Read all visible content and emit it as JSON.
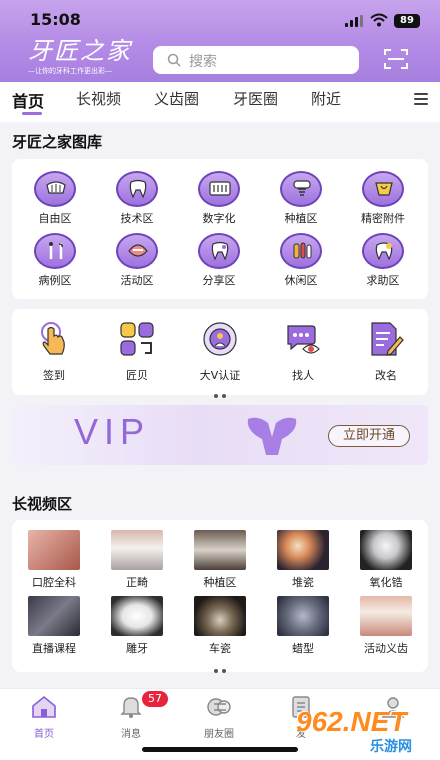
{
  "status_bar": {
    "time": "15:08",
    "battery": "89"
  },
  "header": {
    "logo_title": "牙匠之家",
    "logo_slogan": "—让你的牙科工作更出彩—",
    "search_placeholder": "搜索"
  },
  "tabs": [
    {
      "label": "首页",
      "active": true
    },
    {
      "label": "长视频",
      "active": false
    },
    {
      "label": "义齿圈",
      "active": false
    },
    {
      "label": "牙医圈",
      "active": false
    },
    {
      "label": "附近",
      "active": false
    }
  ],
  "gallery": {
    "title": "牙匠之家图库",
    "items": [
      {
        "label": "自由区",
        "icon": "teeth-icon"
      },
      {
        "label": "技术区",
        "icon": "tooth-icon"
      },
      {
        "label": "数字化",
        "icon": "digital-teeth-icon"
      },
      {
        "label": "种植区",
        "icon": "implant-icon"
      },
      {
        "label": "精密附件",
        "icon": "crown-icon"
      },
      {
        "label": "病例区",
        "icon": "dental-tools-icon"
      },
      {
        "label": "活动区",
        "icon": "denture-icon"
      },
      {
        "label": "分享区",
        "icon": "share-tooth-icon"
      },
      {
        "label": "休闲区",
        "icon": "leisure-icon"
      },
      {
        "label": "求助区",
        "icon": "help-icon"
      }
    ]
  },
  "tools": {
    "items": [
      {
        "label": "签到",
        "icon": "tap-hand-icon"
      },
      {
        "label": "匠贝",
        "icon": "coin-icon"
      },
      {
        "label": "大V认证",
        "icon": "verified-badge-icon"
      },
      {
        "label": "找人",
        "icon": "chat-find-icon"
      },
      {
        "label": "改名",
        "icon": "edit-doc-icon"
      }
    ]
  },
  "vip_banner": {
    "text": "VIP",
    "button": "立即开通"
  },
  "videos": {
    "title": "长视频区",
    "items": [
      {
        "label": "口腔全科",
        "color": "#c98a7a"
      },
      {
        "label": "正畸",
        "color": "#b9a3a0"
      },
      {
        "label": "种植区",
        "color": "#5d5046"
      },
      {
        "label": "堆瓷",
        "color": "#3b3038"
      },
      {
        "label": "氧化锆",
        "color": "#6d6a70"
      },
      {
        "label": "直播课程",
        "color": "#4a4a55"
      },
      {
        "label": "雕牙",
        "color": "#dcdcdc"
      },
      {
        "label": "车瓷",
        "color": "#3a302a"
      },
      {
        "label": "蜡型",
        "color": "#6e7284"
      },
      {
        "label": "活动义齿",
        "color": "#c7a39a"
      }
    ]
  },
  "bottom_nav": [
    {
      "label": "首页",
      "icon": "home-icon",
      "active": true
    },
    {
      "label": "消息",
      "icon": "bell-icon",
      "active": false
    },
    {
      "label": "朋友圈",
      "icon": "friends-icon",
      "active": false
    },
    {
      "label": "发",
      "icon": "publish-icon",
      "active": false
    },
    {
      "label": "",
      "icon": "profile-icon",
      "active": false
    }
  ],
  "message_badge": "57",
  "watermark": {
    "number": "962.NET",
    "text": "乐游网"
  },
  "colors": {
    "primary": "#9b6be0",
    "badge": "#e8243c"
  }
}
